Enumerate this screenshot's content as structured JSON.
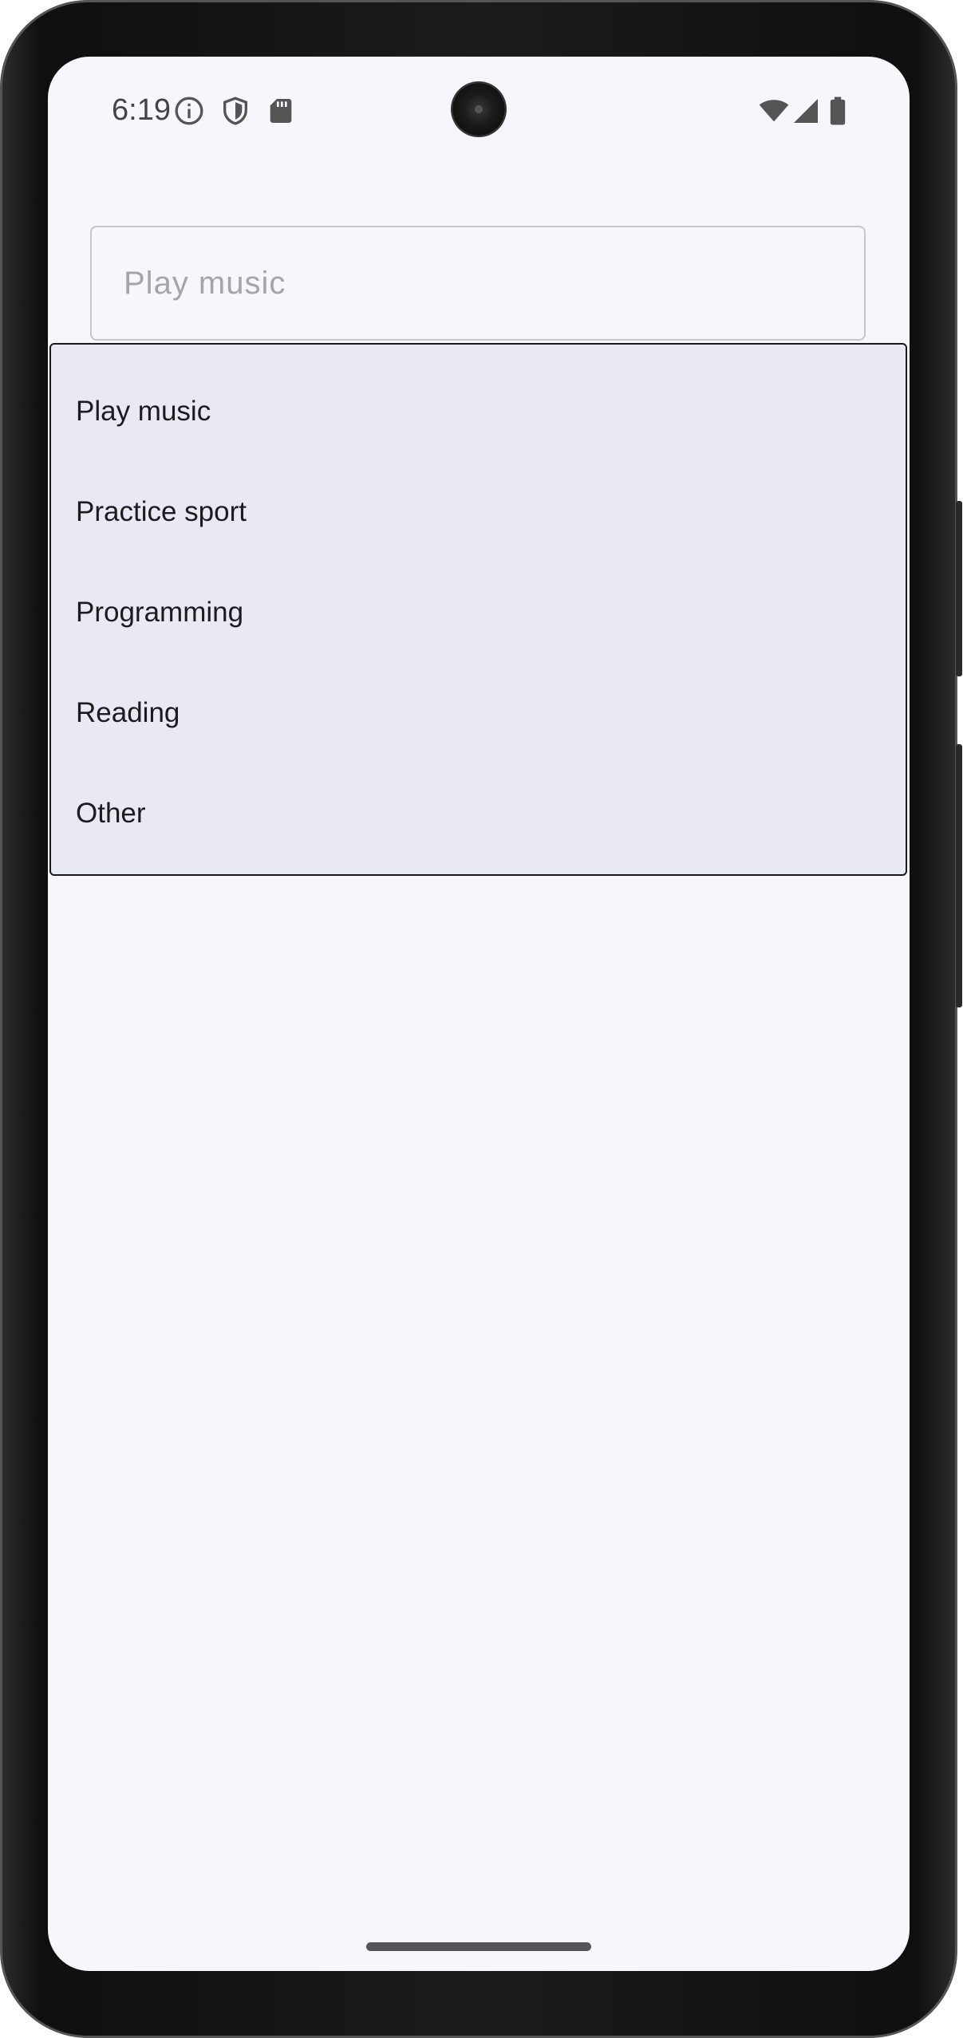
{
  "status_bar": {
    "time": "6:19",
    "icons_left": [
      "info-icon",
      "shield-icon",
      "sd-card-icon"
    ],
    "icons_right": [
      "wifi-icon",
      "cellular-signal-icon",
      "battery-icon"
    ]
  },
  "field": {
    "value": "Play music"
  },
  "dropdown": {
    "items": [
      {
        "label": "Play music"
      },
      {
        "label": "Practice sport"
      },
      {
        "label": "Programming"
      },
      {
        "label": "Reading"
      },
      {
        "label": "Other"
      }
    ]
  },
  "colors": {
    "screen_background": "#f7f6fc",
    "menu_background": "#e9e9f3",
    "menu_text": "#1c1b20",
    "field_text": "#a6a4ab",
    "field_border": "#c6c5cc"
  }
}
